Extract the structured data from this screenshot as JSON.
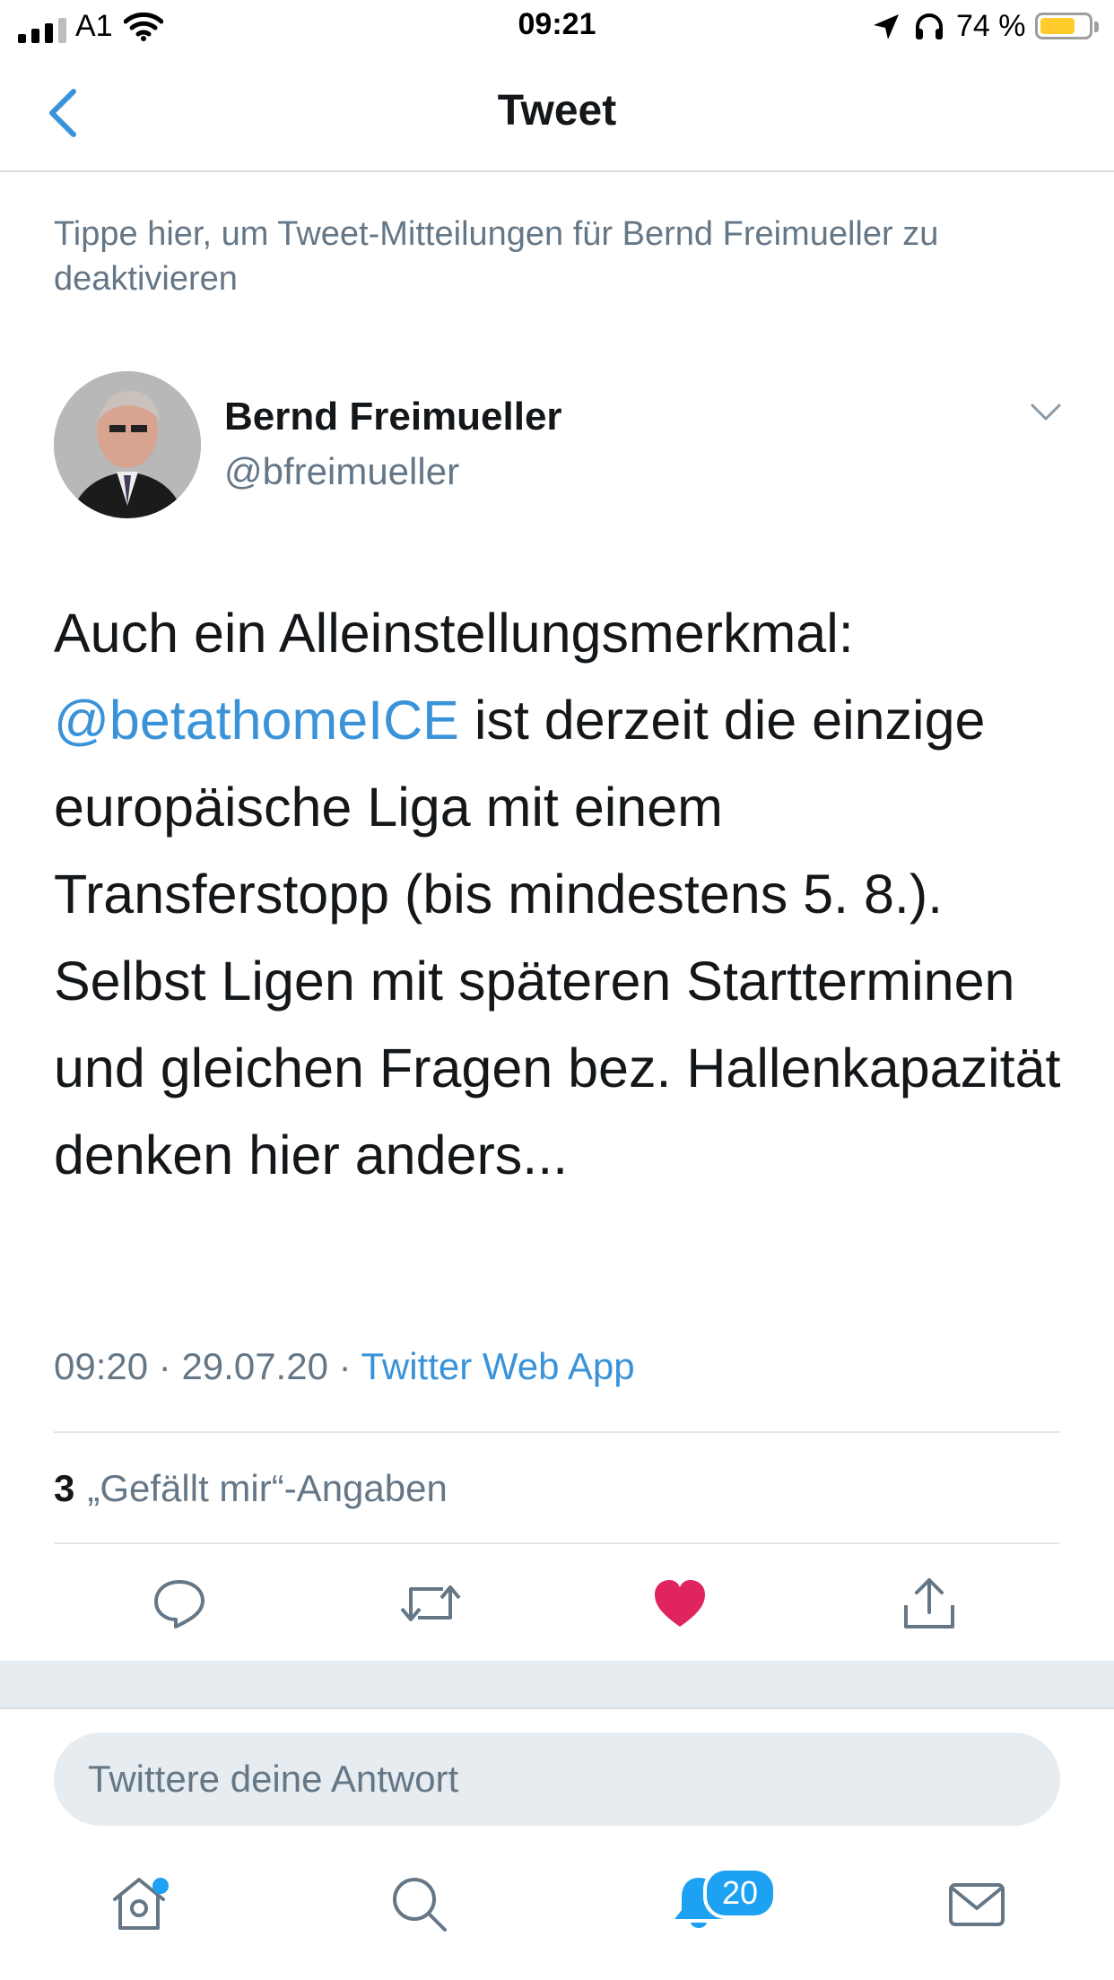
{
  "status_bar": {
    "carrier": "A1",
    "time": "09:21",
    "battery_percent": "74 %",
    "battery_level": 0.74
  },
  "nav": {
    "title": "Tweet",
    "back_icon": "chevron-left-icon"
  },
  "notice": "Tippe hier, um Tweet-Mitteilungen für Bernd Freimueller zu deaktivieren",
  "tweet": {
    "author_name": "Bernd Freimueller",
    "author_handle": "@bfreimueller",
    "text_before": "Auch ein Alleinstellungsmerkmal: ",
    "mention": "@betathomeICE",
    "text_after": " ist derzeit die einzige europäische Liga mit einem Transferstopp (bis mindestens 5. 8.). Selbst Ligen mit späteren Startterminen und gleichen Fragen bez. Hallenkapazität denken hier anders...",
    "time": "09:20",
    "date": "29.07.20",
    "separator": "·",
    "source": "Twitter Web App",
    "likes_count": "3",
    "likes_label": "„Gefällt mir“-Angaben",
    "liked": true
  },
  "actions": [
    "reply-icon",
    "retweet-icon",
    "like-icon",
    "share-icon"
  ],
  "reply_placeholder": "Twittere deine Antwort",
  "tab_bar": {
    "items": [
      "home-icon",
      "search-icon",
      "notifications-icon",
      "messages-icon"
    ],
    "notifications_badge": "20"
  },
  "colors": {
    "accent": "#1da1f2",
    "link": "#3a93d8",
    "like": "#e0245e",
    "secondary_text": "#657786"
  }
}
